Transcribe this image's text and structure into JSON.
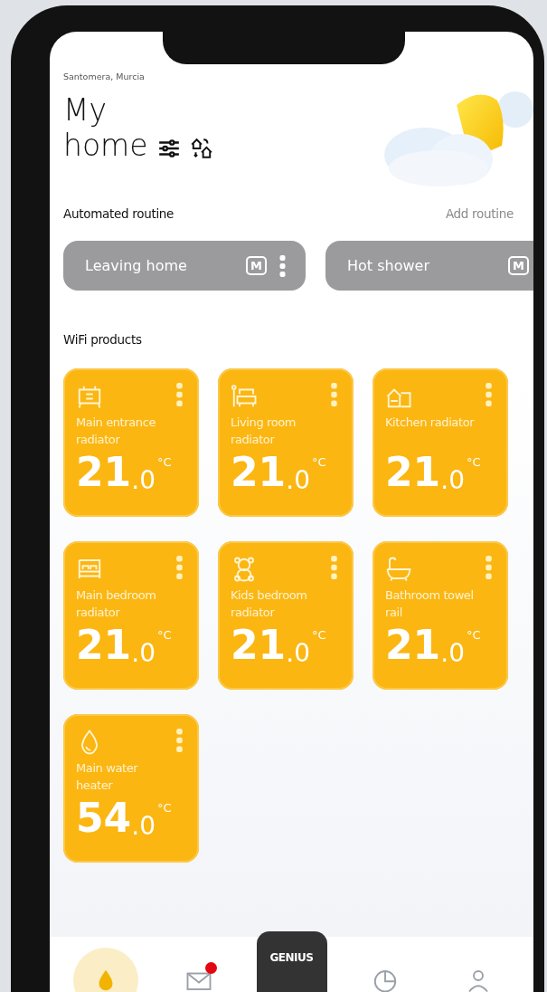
{
  "header": {
    "location": "Santomera, Murcia",
    "title_line1": "My",
    "title_line2": "home"
  },
  "routines": {
    "title": "Automated routine",
    "action": "Add routine",
    "items": [
      {
        "label": "Leaving home",
        "mode": "M"
      },
      {
        "label": "Hot shower",
        "mode": "M"
      }
    ]
  },
  "products": {
    "title": "WiFi products",
    "items": [
      {
        "kind": "entrance",
        "name": "Main entrance radiator",
        "value": "21",
        "decimal": ".0",
        "unit": "°C"
      },
      {
        "kind": "living",
        "name": "Living room radiator",
        "value": "21",
        "decimal": ".0",
        "unit": "°C"
      },
      {
        "kind": "kitchen",
        "name": "Kitchen radiator",
        "value": "21",
        "decimal": ".0",
        "unit": "°C"
      },
      {
        "kind": "bedroom",
        "name": "Main bedroom radiator",
        "value": "21",
        "decimal": ".0",
        "unit": "°C"
      },
      {
        "kind": "kids",
        "name": "Kids bedroom radiator",
        "value": "21",
        "decimal": ".0",
        "unit": "°C"
      },
      {
        "kind": "bathroom",
        "name": "Bathroom towel rail",
        "value": "21",
        "decimal": ".0",
        "unit": "°C"
      },
      {
        "kind": "water",
        "name": "Main water heater",
        "value": "54",
        "decimal": ".0",
        "unit": "°C"
      }
    ]
  },
  "nav": {
    "items": [
      {
        "kind": "home",
        "selected": true,
        "badge": false
      },
      {
        "kind": "mail",
        "selected": false,
        "badge": true
      },
      {
        "kind": "center",
        "selected": false,
        "label": "GENIUS"
      },
      {
        "kind": "chart",
        "selected": false,
        "badge": false
      },
      {
        "kind": "user",
        "selected": false,
        "badge": false
      }
    ]
  }
}
